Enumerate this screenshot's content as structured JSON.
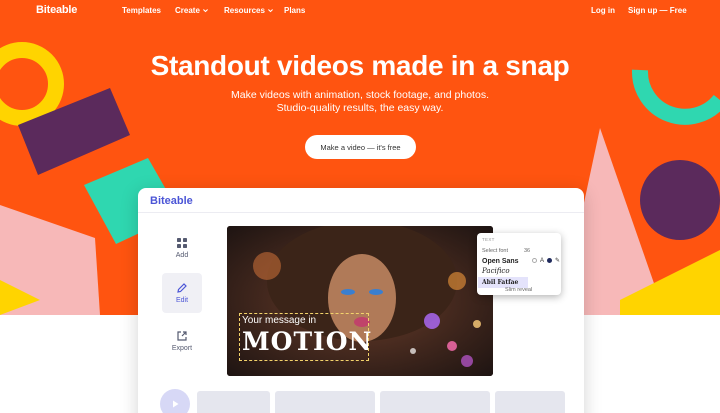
{
  "nav": {
    "logo": "Biteable",
    "items": [
      {
        "label": "Templates",
        "dropdown": false
      },
      {
        "label": "Create",
        "dropdown": true
      },
      {
        "label": "Resources",
        "dropdown": true
      },
      {
        "label": "Plans",
        "dropdown": false
      }
    ],
    "login": "Log in",
    "signup": "Sign up — Free"
  },
  "hero": {
    "headline": "Standout videos made in a snap",
    "sub_line1": "Make videos with animation, stock footage, and photos.",
    "sub_line2": "Studio-quality results, the easy way.",
    "cta": "Make a video — it's free"
  },
  "app": {
    "logo": "Biteable",
    "sidebar": [
      {
        "label": "Add",
        "icon": "grid-icon",
        "active": false
      },
      {
        "label": "Edit",
        "icon": "pencil-icon",
        "active": true
      },
      {
        "label": "Export",
        "icon": "export-icon",
        "active": false
      }
    ],
    "caption_small": "Your message in",
    "caption_big": "MOTION",
    "font_panel": {
      "label": "TEXT",
      "select_placeholder": "Select font",
      "size": "36",
      "fonts": [
        "Open Sans",
        "Pacifico",
        "Abil Fatfae"
      ],
      "selected_font": "Abil Fatfae",
      "animation": "Slim reveal"
    }
  },
  "colors": {
    "hero_bg": "#ff5410",
    "accent": "#4b55d6",
    "yellow": "#ffd400",
    "purple": "#5b2a5c",
    "teal": "#2fd7b0",
    "pink": "#f7b8b8"
  }
}
